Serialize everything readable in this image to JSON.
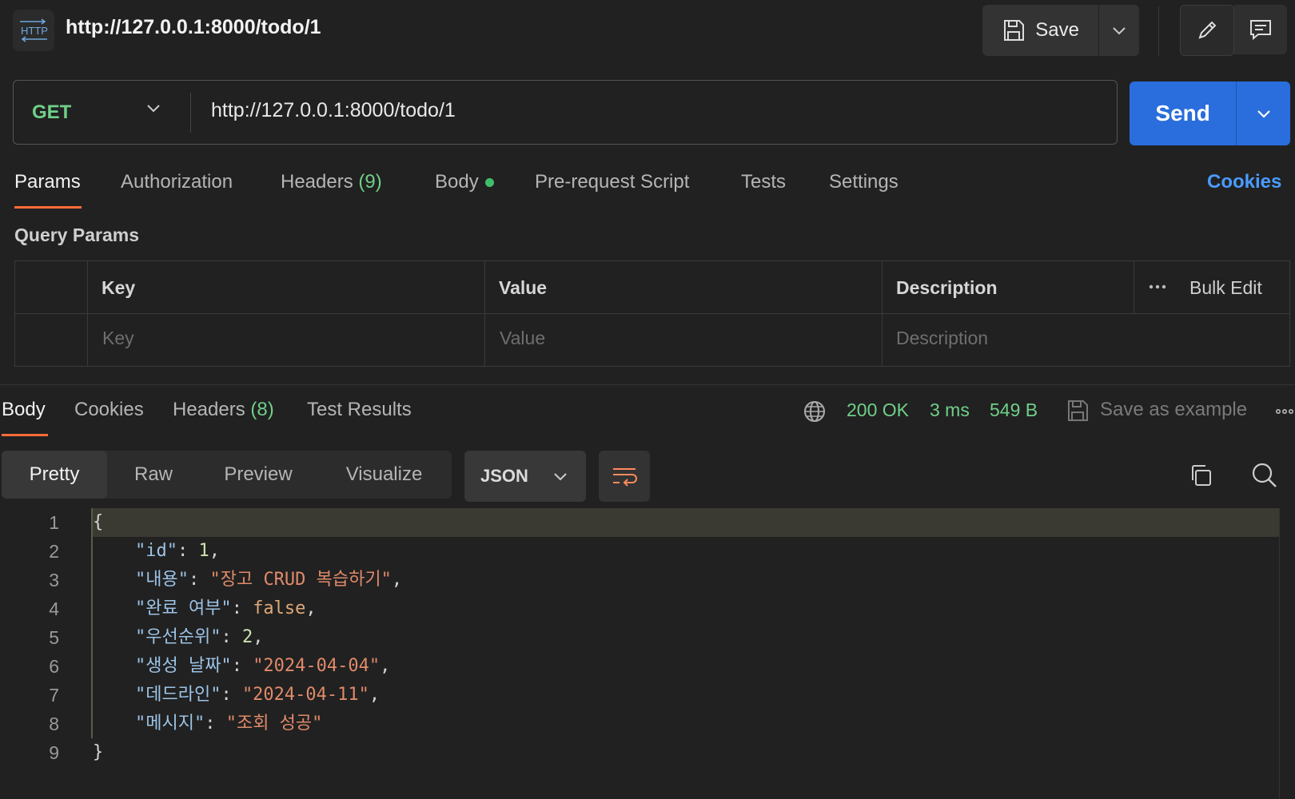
{
  "header": {
    "title": "http://127.0.0.1:8000/todo/1",
    "icon": "http-icon",
    "save_label": "Save"
  },
  "request": {
    "method": "GET",
    "url": "http://127.0.0.1:8000/todo/1",
    "send_label": "Send",
    "tabs": [
      {
        "label": "Params",
        "count": ""
      },
      {
        "label": "Authorization",
        "count": ""
      },
      {
        "label": "Headers",
        "count": "(9)"
      },
      {
        "label": "Body",
        "count": ""
      },
      {
        "label": "Pre-request Script",
        "count": ""
      },
      {
        "label": "Tests",
        "count": ""
      },
      {
        "label": "Settings",
        "count": ""
      }
    ],
    "cookies_label": "Cookies",
    "query_params_title": "Query Params",
    "table": {
      "headers": [
        "Key",
        "Value",
        "Description"
      ],
      "bulk_edit": "Bulk Edit",
      "placeholders": [
        "Key",
        "Value",
        "Description"
      ]
    }
  },
  "response": {
    "tabs": [
      {
        "label": "Body",
        "count": ""
      },
      {
        "label": "Cookies",
        "count": ""
      },
      {
        "label": "Headers",
        "count": "(8)"
      },
      {
        "label": "Test Results",
        "count": ""
      }
    ],
    "status": "200 OK",
    "time": "3 ms",
    "size": "549 B",
    "save_example": "Save as example",
    "views": [
      "Pretty",
      "Raw",
      "Preview",
      "Visualize"
    ],
    "format": "JSON",
    "code_lines": [
      {
        "n": "1",
        "text": "{"
      },
      {
        "n": "2",
        "key": "\"id\"",
        "value": "1",
        "vtype": "num",
        "trail": ","
      },
      {
        "n": "3",
        "key": "\"내용\"",
        "value": "\"장고 CRUD 복습하기\"",
        "vtype": "str",
        "trail": ","
      },
      {
        "n": "4",
        "key": "\"완료 여부\"",
        "value": "false",
        "vtype": "bool",
        "trail": ","
      },
      {
        "n": "5",
        "key": "\"우선순위\"",
        "value": "2",
        "vtype": "num",
        "trail": ","
      },
      {
        "n": "6",
        "key": "\"생성 날짜\"",
        "value": "\"2024-04-04\"",
        "vtype": "str",
        "trail": ","
      },
      {
        "n": "7",
        "key": "\"데드라인\"",
        "value": "\"2024-04-11\"",
        "vtype": "str",
        "trail": ","
      },
      {
        "n": "8",
        "key": "\"메시지\"",
        "value": "\"조회 성공\"",
        "vtype": "str",
        "trail": ""
      },
      {
        "n": "9",
        "text": "}"
      }
    ]
  },
  "colors": {
    "accent": "#ff6c37",
    "send": "#2a6ddc",
    "method": "#6fcf88",
    "link": "#4a9bff"
  }
}
